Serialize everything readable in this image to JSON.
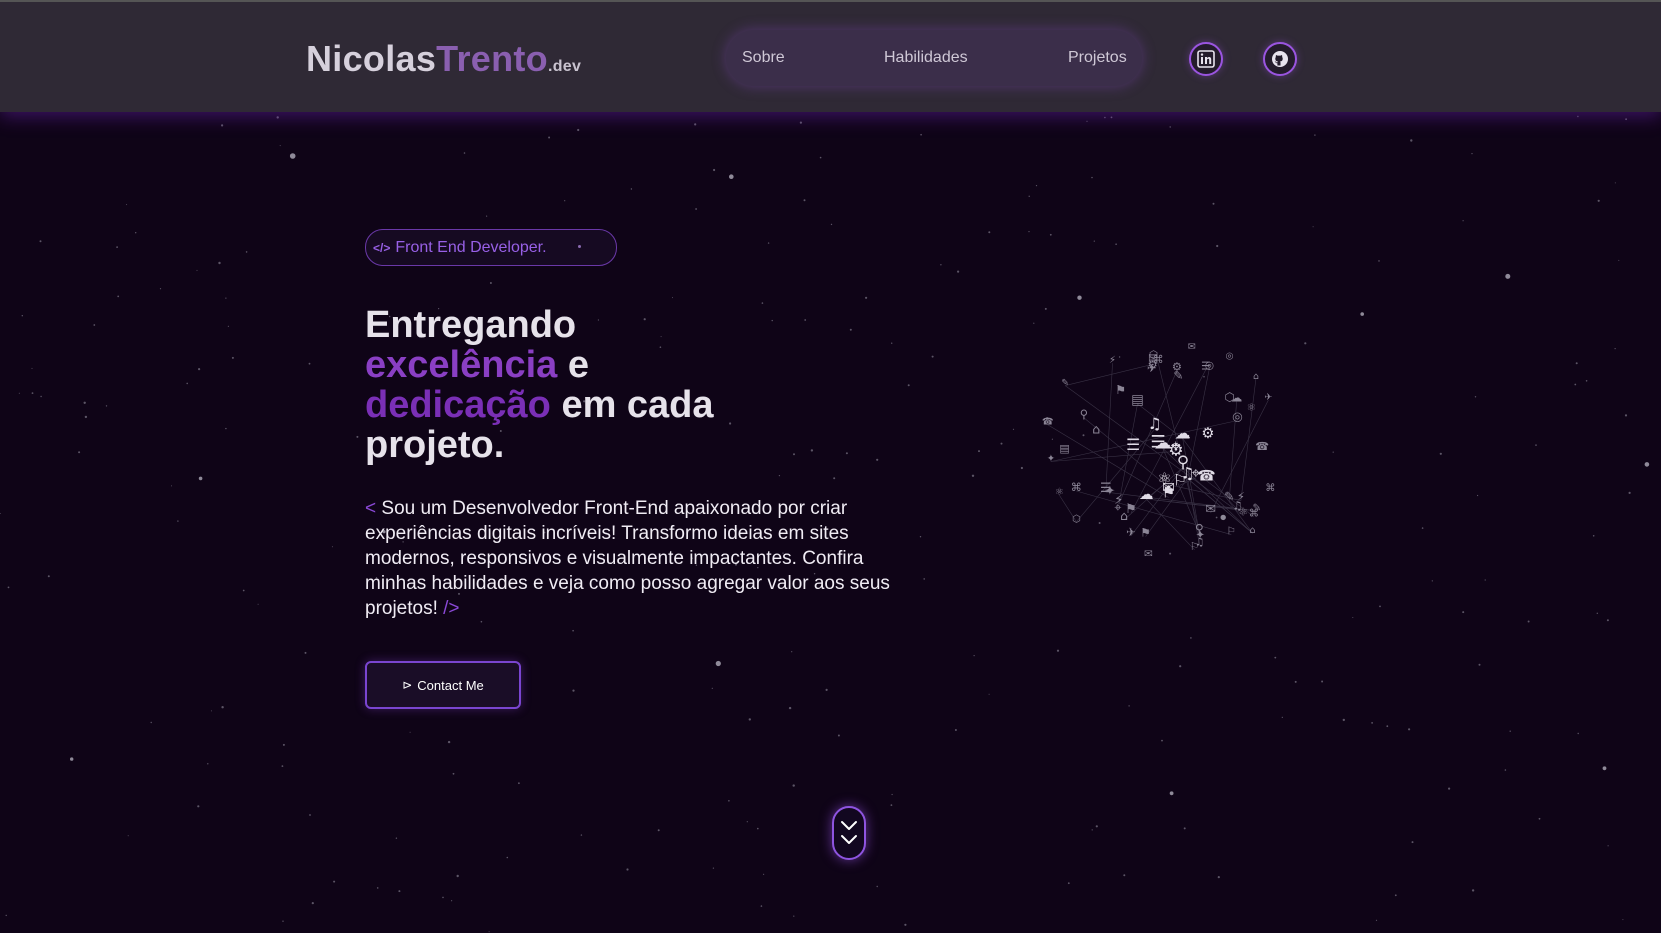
{
  "header": {
    "logo": {
      "part1": "Nicolas",
      "part2": "Trento",
      "part3": ".dev"
    },
    "nav": [
      {
        "label": "Sobre"
      },
      {
        "label": "Habilidades"
      },
      {
        "label": "Projetos"
      }
    ],
    "social": [
      {
        "icon": "linkedin-icon"
      },
      {
        "icon": "github-icon"
      }
    ]
  },
  "hero": {
    "badge": {
      "icon": "code-icon",
      "text": "Front End Developer."
    },
    "headline": {
      "line1": "Entregando",
      "highlight1": "excelência",
      "and": "e",
      "highlight2": "dedicação",
      "rest1": "em cada",
      "rest2": "projeto."
    },
    "description": {
      "open_tag": "<",
      "text": "Sou um Desenvolvedor Front-End apaixonado por criar experiências digitais incríveis! Transformo ideias em sites modernos, responsivos e visualmente impactantes. Confira minhas habilidades e veja como posso agregar valor aos seus projetos!",
      "close_tag": "/>"
    },
    "cta": {
      "icon": "send-icon",
      "label": "Contact Me"
    }
  },
  "scroll_indicator": {
    "icon": "double-chevron-down-icon"
  },
  "colors": {
    "background": "#0f0417",
    "header": "#2f2935",
    "accent": "#8a3fc4",
    "accent_border": "#9a55e0"
  }
}
